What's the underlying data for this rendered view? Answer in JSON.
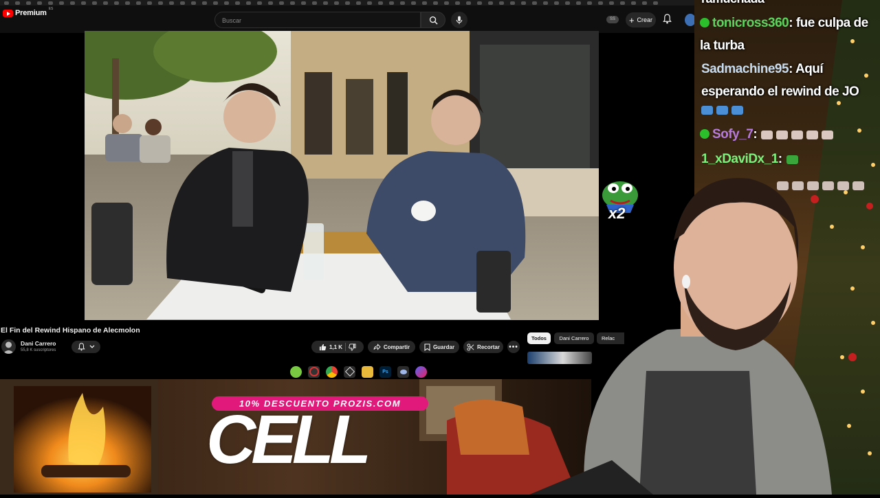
{
  "youtube": {
    "logo_text": "Premium",
    "logo_region": "ES",
    "search_placeholder": "Buscar",
    "create_label": "Crear",
    "ext_badge": "SS"
  },
  "video": {
    "title": "El Fin del Rewind Hispano de Alecmolon",
    "overlay_emote_label": "x2"
  },
  "channel": {
    "name": "Dani Carrero",
    "subscribers": "55,8 K suscriptores"
  },
  "actions": {
    "likes": "1,1 K",
    "share": "Compartir",
    "save": "Guardar",
    "clip": "Recortar"
  },
  "chips": [
    "Todos",
    "Dani Carrero",
    "Relac"
  ],
  "promo": {
    "code_text": "10% DESCUENTO PROZIS.COM",
    "big_text": "CELL"
  },
  "chat": {
    "top_partial": "ramuchada",
    "messages": [
      {
        "user": "tonicross360",
        "color": "#5fd35f",
        "text": ": fue culpa de la turba",
        "badge": true
      },
      {
        "user": "Sadmachine95",
        "color": "#c9dcef",
        "text": ": Aquí esperando el rewind de JO",
        "badge": false
      },
      {
        "user": "Sofy_7",
        "color": "#b77be0",
        "text": ":",
        "badge": true
      },
      {
        "user": "1_xDaviDx_1",
        "color": "#7cf27c",
        "text": ":",
        "badge": false
      }
    ]
  }
}
